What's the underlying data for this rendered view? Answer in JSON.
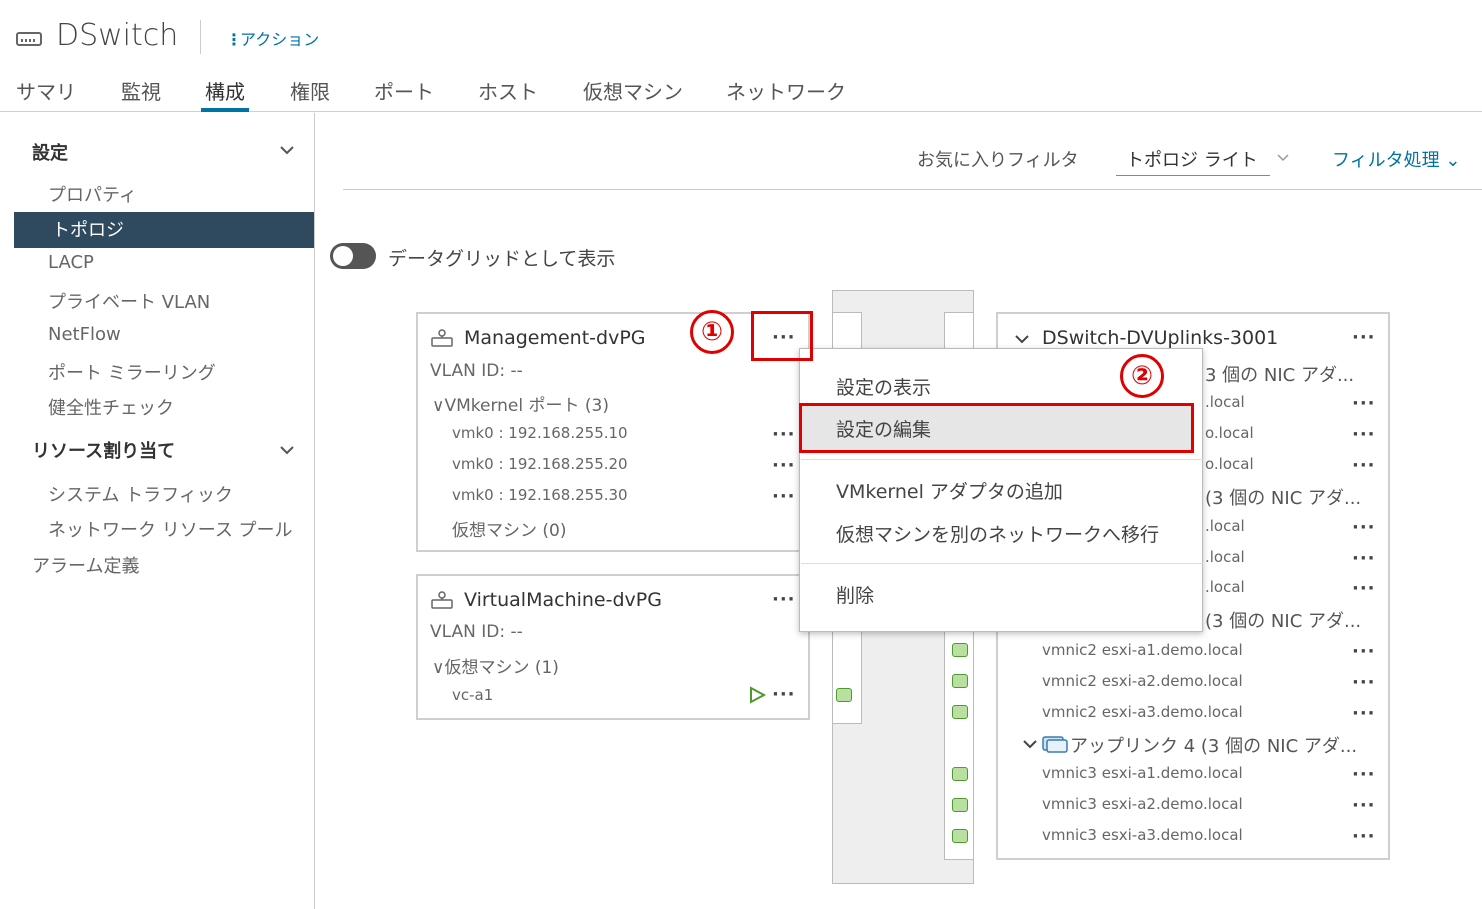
{
  "header": {
    "title": "DSwitch",
    "actions_label": "アクション",
    "tabs": [
      "サマリ",
      "監視",
      "構成",
      "権限",
      "ポート",
      "ホスト",
      "仮想マシン",
      "ネットワーク"
    ],
    "active_tab": "構成"
  },
  "sidebar": {
    "section_settings": "設定",
    "settings_items": [
      "プロパティ",
      "トポロジ",
      "LACP",
      "プライベート VLAN",
      "NetFlow",
      "ポート ミラーリング",
      "健全性チェック"
    ],
    "selected_item": "トポロジ",
    "section_resources": "リソース割り当て",
    "resources_items": [
      "システム トラフィック",
      "ネットワーク リソース プール"
    ],
    "alarm_item": "アラーム定義"
  },
  "filter_bar": {
    "favorites_label": "お気に入りフィルタ",
    "topology_select": "トポロジ ライト",
    "filter_action": "フィルタ処理"
  },
  "toggle": {
    "label": "データグリッドとして表示",
    "on": false
  },
  "mgmt_pg": {
    "name": "Management-dvPG",
    "vlan": "VLAN ID: --",
    "vmkernel_ports": "VMkernel ポート (3)",
    "vmk": [
      "vmk0 : 192.168.255.10",
      "vmk0 : 192.168.255.20",
      "vmk0 : 192.168.255.30"
    ],
    "vms": "仮想マシン (0)"
  },
  "vm_pg": {
    "name": "VirtualMachine-dvPG",
    "vlan": "VLAN ID: --",
    "vms": "仮想マシン (1)",
    "vm": "vc-a1"
  },
  "uplinks": {
    "name": "DSwitch-DVUplinks-3001",
    "group1_tail": "3 個の NIC アダ...",
    "rows_partial": [
      ".local",
      "o.local",
      "o.local",
      ".local",
      ".local",
      ".local"
    ],
    "group2_tail": "(3 個の NIC アダ...",
    "group3_tail": "(3 個の NIC アダ...",
    "vmnic2": [
      "vmnic2 esxi-a1.demo.local",
      "vmnic2 esxi-a2.demo.local",
      "vmnic2 esxi-a3.demo.local"
    ],
    "group4": "アップリンク 4 (3 個の NIC アダ...",
    "vmnic3": [
      "vmnic3 esxi-a1.demo.local",
      "vmnic3 esxi-a2.demo.local",
      "vmnic3 esxi-a3.demo.local"
    ]
  },
  "context_menu": {
    "items": [
      "設定の表示",
      "設定の編集",
      "VMkernel アダプタの追加",
      "仮想マシンを別のネットワークへ移行",
      "削除"
    ],
    "highlighted": "設定の編集"
  },
  "annotations": {
    "step1": "①",
    "step2": "②",
    "highlight_color": "#e00000"
  },
  "colors": {
    "accent": "#0072a3",
    "selected_nav_bg": "#2f4a5f",
    "port_green": "#4e9a2e"
  }
}
